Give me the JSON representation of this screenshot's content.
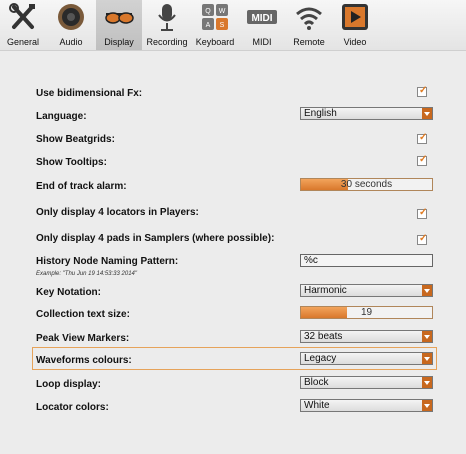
{
  "tabs": [
    {
      "label": "General",
      "icon": "tools-icon"
    },
    {
      "label": "Audio",
      "icon": "speaker-icon"
    },
    {
      "label": "Display",
      "icon": "sunglasses-icon"
    },
    {
      "label": "Recording",
      "icon": "microphone-icon"
    },
    {
      "label": "Keyboard",
      "icon": "keyboard-keys-icon"
    },
    {
      "label": "MIDI",
      "icon": "midi-icon"
    },
    {
      "label": "Remote",
      "icon": "wifi-icon"
    },
    {
      "label": "Video",
      "icon": "video-play-icon"
    }
  ],
  "active_tab": "Display",
  "keyboard_keys": [
    "Q",
    "W",
    "A",
    "S"
  ],
  "midi_text": "MIDI",
  "settings": {
    "bidimensional": {
      "label": "Use bidimensional Fx:",
      "checked": true
    },
    "language": {
      "label": "Language:",
      "value": "English"
    },
    "beatgrids": {
      "label": "Show Beatgrids:",
      "checked": true
    },
    "tooltips": {
      "label": "Show Tooltips:",
      "checked": true
    },
    "alarm": {
      "label": "End of track alarm:",
      "value": "30 seconds",
      "fill_percent": 36
    },
    "locators": {
      "label": "Only display 4 locators in Players:",
      "checked": true
    },
    "pads": {
      "label": "Only display 4 pads in Samplers (where possible):",
      "checked": true
    },
    "history": {
      "label": "History Node Naming Pattern:",
      "value": "%c",
      "example": "Example: \"Thu Jun 19 14:53:33 2014\""
    },
    "key_notation": {
      "label": "Key Notation:",
      "value": "Harmonic"
    },
    "text_size": {
      "label": "Collection text size:",
      "value": "19",
      "fill_percent": 35
    },
    "peak_markers": {
      "label": "Peak View Markers:",
      "value": "32 beats"
    },
    "waveform_colours": {
      "label": "Waveforms colours:",
      "value": "Legacy"
    },
    "loop_display": {
      "label": "Loop display:",
      "value": "Block"
    },
    "locator_colors": {
      "label": "Locator colors:",
      "value": "White"
    }
  },
  "colors": {
    "accent": "#d9782c",
    "highlight_border": "#e6a35a"
  }
}
